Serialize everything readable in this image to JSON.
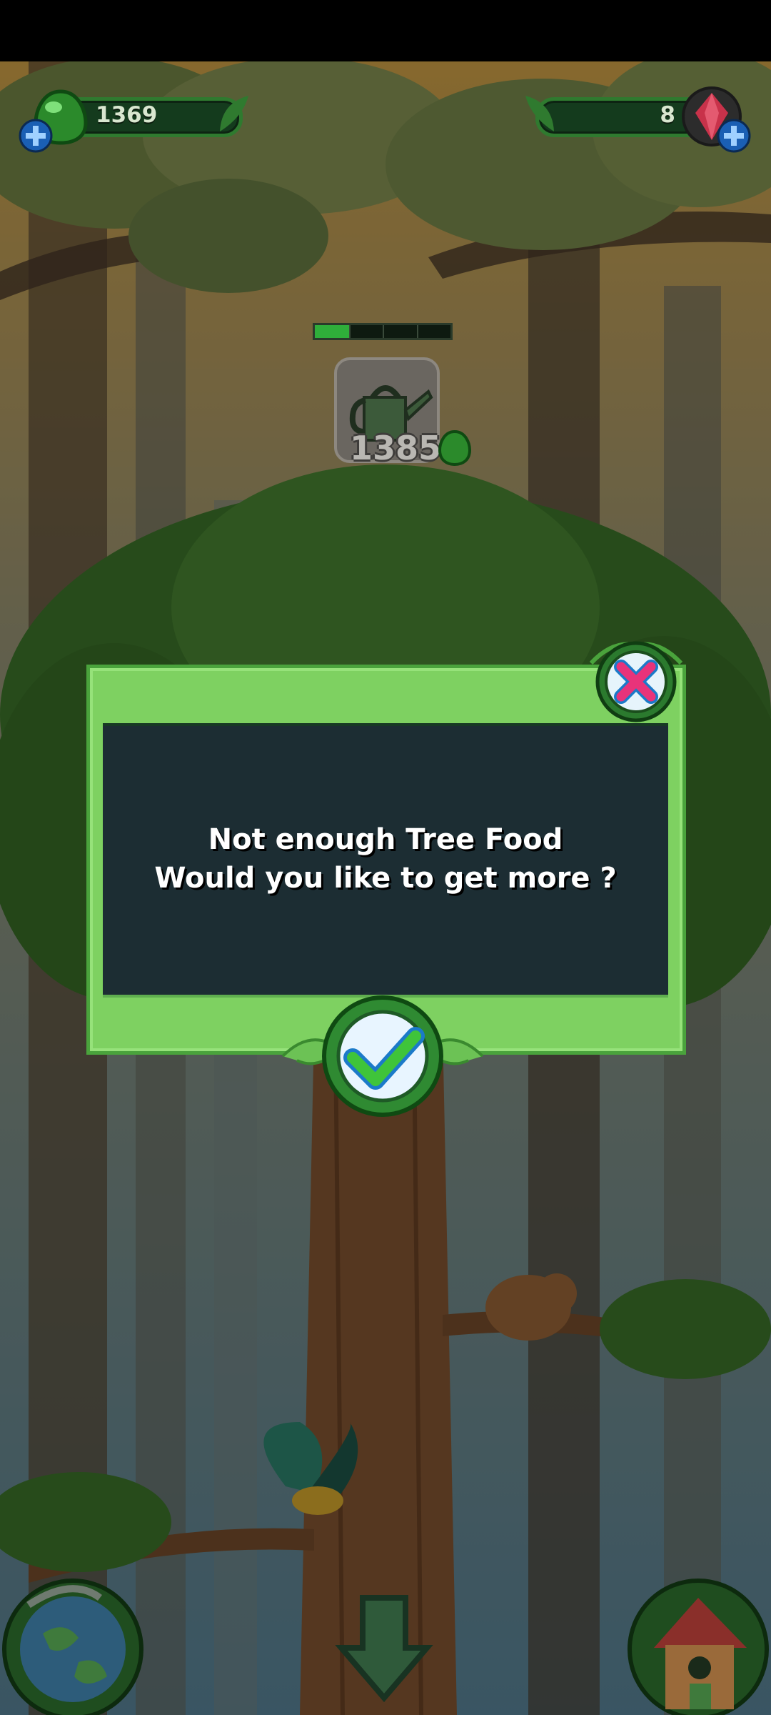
{
  "hud": {
    "tree_food_count": "1369",
    "gems_count": "8"
  },
  "water": {
    "progress": 0.25,
    "segments": 4,
    "cost": "1385"
  },
  "dialog": {
    "line1": "Not enough Tree Food",
    "line2": "Would you like to get more ?"
  },
  "icons": {
    "tree_food": "green-drop-icon",
    "gem": "red-gem-icon",
    "add": "plus-icon",
    "close": "close-x-icon",
    "confirm": "checkmark-icon",
    "map": "globe-icon",
    "down": "down-arrow-icon",
    "home": "house-icon"
  },
  "colors": {
    "dialog_frame": "#7ed161",
    "dialog_body": "#1c2d33",
    "close_x": "#e8337a",
    "confirm_check": "#3fc43a"
  }
}
